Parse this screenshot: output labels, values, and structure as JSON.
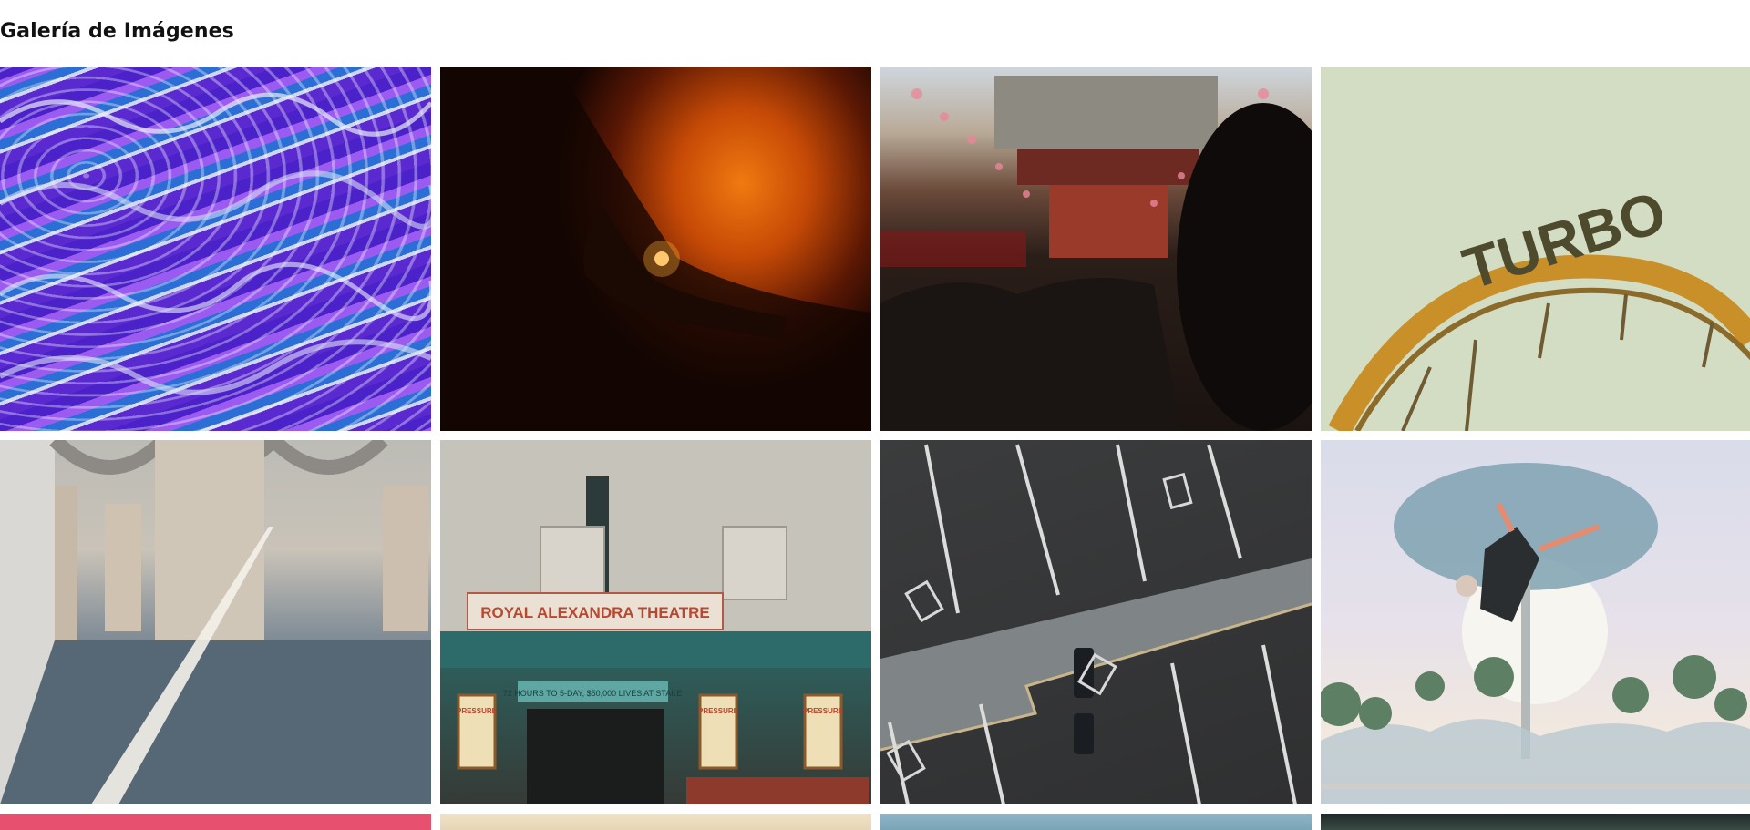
{
  "gallery": {
    "title": "Galería de Imágenes",
    "images": [
      {
        "subject": "purple metallic waves"
      },
      {
        "subject": "hand against orange light"
      },
      {
        "subject": "crowded temple street with lanterns"
      },
      {
        "subject": "turbo sign on roller coaster",
        "sign_text": "TURBO"
      },
      {
        "subject": "concrete arcade with light beam"
      },
      {
        "subject": "theatre facade",
        "marquee_text": "ROYAL ALEXANDRA THEATRE",
        "banner_text": "72 HOURS TO 5-DAY, $50,000 LIVES AT STAKE",
        "poster_text": "PRESSURE"
      },
      {
        "subject": "aerial parking lot with carts"
      },
      {
        "subject": "person falling from tree in surreal landscape"
      },
      {
        "subject": "pink"
      },
      {
        "subject": "sand"
      },
      {
        "subject": "sky"
      },
      {
        "subject": "dark"
      }
    ]
  }
}
